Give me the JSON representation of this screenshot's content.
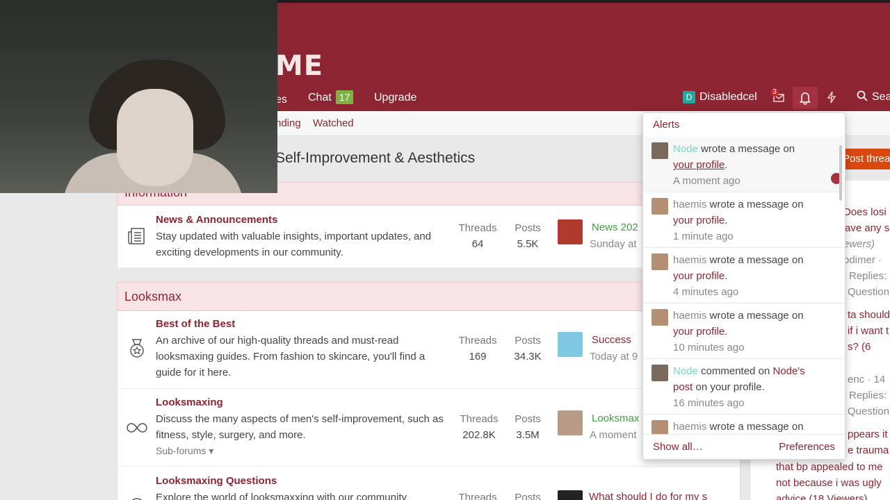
{
  "header": {
    "logo_text": "ME",
    "nav": [
      {
        "label": "es"
      },
      {
        "label": "Chat",
        "badge": "17"
      },
      {
        "label": "Upgrade"
      }
    ],
    "user": {
      "initial": "D",
      "name": "Disabledcel"
    },
    "conversations_count": "3",
    "search_label": "Sea"
  },
  "subnav": [
    "nding",
    "Watched"
  ],
  "page": {
    "title": "Self-Improvement & Aesthetics",
    "post_thread_label": "Post threa",
    "partial_block_title": "Information"
  },
  "blocks": [
    {
      "title": "Looksmax"
    }
  ],
  "nodes": [
    {
      "title": "News & Announcements",
      "desc": "Stay updated with valuable insights, important updates, and exciting developments in our community.",
      "threads_label": "Threads",
      "threads": "64",
      "posts_label": "Posts",
      "posts": "5.5K",
      "last_title": "News  202",
      "last_date": "Sunday at"
    },
    {
      "title": "Best of the Best",
      "desc": "An archive of our high-quality threads and must-read looksmaxing guides. From fashion to skincare, you'll find a guide for it here.",
      "threads_label": "Threads",
      "threads": "169",
      "posts_label": "Posts",
      "posts": "34.3K",
      "last_title": "Success",
      "last_date": "Today at 9"
    },
    {
      "title": "Looksmaxing",
      "desc": "Discuss the many aspects of men's self-improvement, such as fitness, style, surgery, and more.",
      "sub": "Sub-forums ▾",
      "threads_label": "Threads",
      "threads": "202.8K",
      "posts_label": "Posts",
      "posts": "3.5M",
      "last_title": "Looksmax",
      "last_date": "A moment"
    },
    {
      "title": "Looksmaxing Questions",
      "desc": "Explore the world of looksmaxxing with our community",
      "threads_label": "Threads",
      "posts_label": "Posts",
      "last_title": "What should I do for my s"
    }
  ],
  "right_column": [
    {
      "text": "Does losi",
      "color": "#8c2431"
    },
    {
      "text": "ave any s",
      "color": "#8c2431"
    },
    {
      "text": "ewers)",
      "color": "#888"
    },
    {
      "text": "odimer ·",
      "color": "#888"
    },
    {
      "text": "Replies:",
      "color": "#888"
    },
    {
      "text": "Question",
      "color": "#888"
    },
    {
      "text": "ta should",
      "color": "#8c2431"
    },
    {
      "text": "if i want t",
      "color": "#8c2431"
    },
    {
      "text": "s? (6",
      "color": "#8c2431"
    },
    {
      "text": "enc · 14",
      "color": "#888"
    },
    {
      "text": "Replies:",
      "color": "#888"
    },
    {
      "text": "Question",
      "color": "#888"
    },
    {
      "text": "ppears it",
      "color": "#8c2431"
    },
    {
      "text": "e trauma",
      "color": "#8c2431"
    },
    {
      "text": "that bp appealed to me",
      "color": "#8c2431"
    },
    {
      "text": "not because i was ugly",
      "color": "#8c2431"
    },
    {
      "text": "advice (18 Viewers)",
      "color": "#8c2431"
    }
  ],
  "alerts": {
    "title": "Alerts",
    "items": [
      {
        "who": "Node",
        "who_accent": true,
        "action": "wrote a message on",
        "link": "your profile",
        "tail": ".",
        "time": "A moment ago",
        "unread": true
      },
      {
        "who": "haemis",
        "who_accent": false,
        "action": "wrote a message on",
        "link": "your profile",
        "tail": ".",
        "time": "1 minute ago",
        "unread": false
      },
      {
        "who": "haemis",
        "who_accent": false,
        "action": "wrote a message on",
        "link": "your profile",
        "tail": ".",
        "time": "4 minutes ago",
        "unread": false
      },
      {
        "who": "haemis",
        "who_accent": false,
        "action": "wrote a message on",
        "link": "your profile",
        "tail": ".",
        "time": "10 minutes ago",
        "unread": false
      },
      {
        "who": "Node",
        "who_accent": true,
        "action": "commented on",
        "link": "Node's post",
        "tail": " on your profile.",
        "time": "16 minutes ago",
        "unread": false
      },
      {
        "who": "haemis",
        "who_accent": false,
        "action": "wrote a message on",
        "link": "",
        "tail": "",
        "time": "",
        "unread": false
      }
    ],
    "show_all": "Show all…",
    "preferences": "Preferences"
  },
  "colors": {
    "brand": "#8c2431",
    "accent_name": "#76d7c4",
    "badge": "#7cb342",
    "post_button": "#d9480f"
  }
}
